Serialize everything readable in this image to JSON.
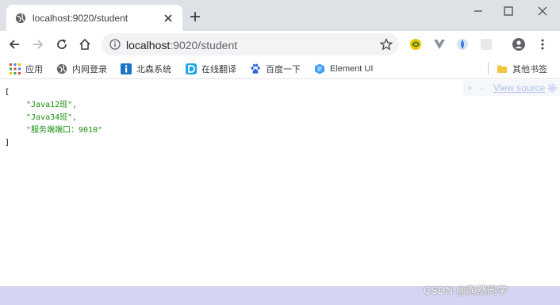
{
  "tab": {
    "title": "localhost:9020/student",
    "favicon": "globe-icon"
  },
  "address_bar": {
    "host": "localhost",
    "path": ":9020/student"
  },
  "bookmarks": [
    {
      "label": "应用",
      "icon": "apps-grid-icon"
    },
    {
      "label": "内网登录",
      "icon": "globe-icon"
    },
    {
      "label": "北森系统",
      "icon": "info-square-icon"
    },
    {
      "label": "在线翻译",
      "icon": "d-square-icon"
    },
    {
      "label": "百度一下",
      "icon": "baidu-paw-icon"
    },
    {
      "label": "Element UI",
      "icon": "element-hex-icon"
    }
  ],
  "other_bookmarks": {
    "label": "其他书签",
    "icon": "folder-icon"
  },
  "json_view": {
    "open_bracket": "[",
    "items": [
      "\"Java12班\",",
      "\"Java34班\",",
      "\"服务端端口：9010\""
    ],
    "close_bracket": "]"
  },
  "viewer": {
    "plus": "+",
    "minus": "-",
    "view_source": "View source"
  },
  "watermark": "CSDN @陶然同学",
  "colors": {
    "json_string": "#1a8f0f",
    "tabstrip": "#dee1e6",
    "omnibox": "#f1f3f4"
  }
}
